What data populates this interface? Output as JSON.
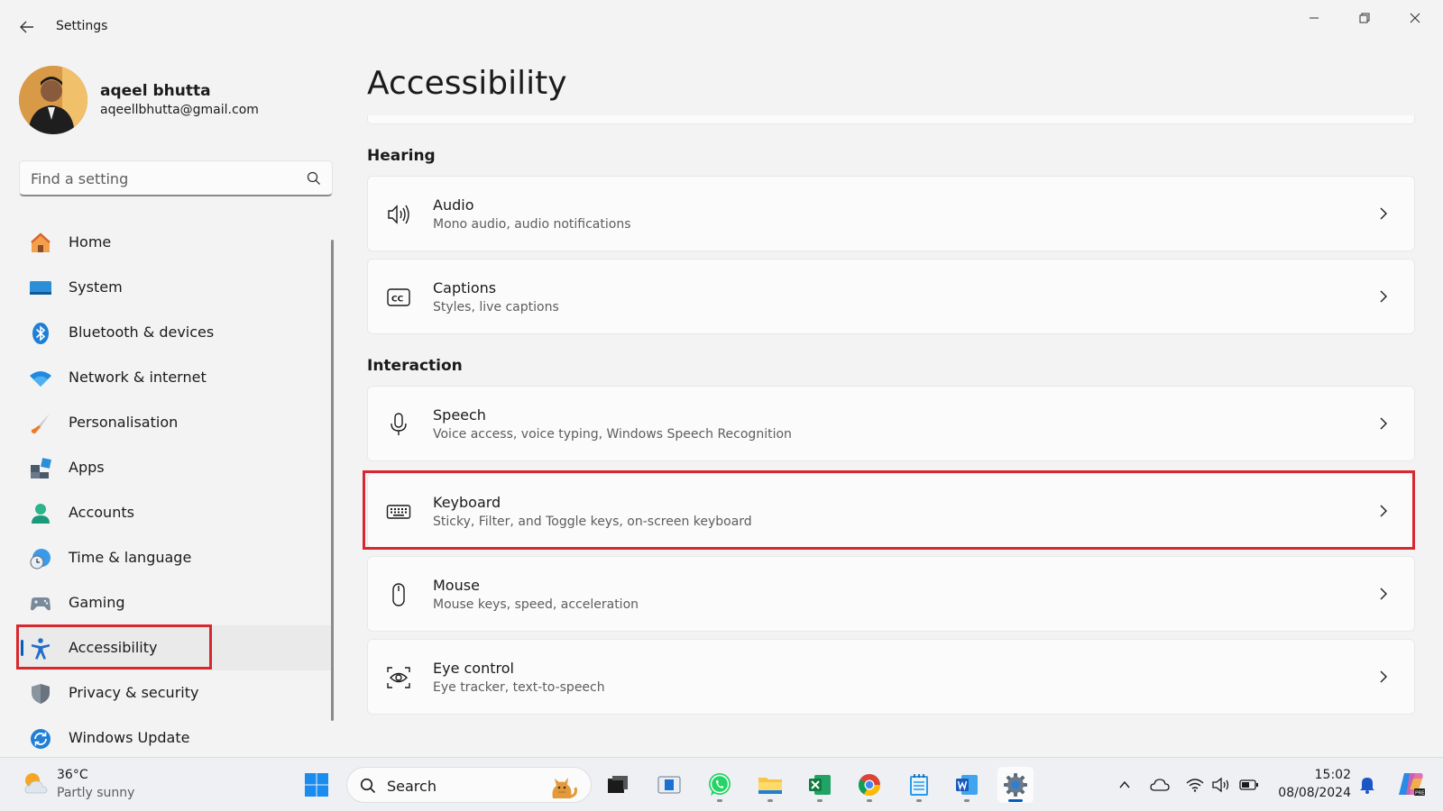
{
  "window": {
    "title": "Settings",
    "back_icon": "back-arrow-icon",
    "controls": [
      "minimize-icon",
      "restore-icon",
      "close-icon"
    ]
  },
  "user": {
    "name": "aqeel bhutta",
    "email": "aqeellbhutta@gmail.com"
  },
  "search": {
    "placeholder": "Find a setting"
  },
  "sidebar": {
    "items": [
      {
        "label": "Home",
        "icon": "home-icon"
      },
      {
        "label": "System",
        "icon": "system-icon"
      },
      {
        "label": "Bluetooth & devices",
        "icon": "bluetooth-icon"
      },
      {
        "label": "Network & internet",
        "icon": "wifi-icon"
      },
      {
        "label": "Personalisation",
        "icon": "brush-icon"
      },
      {
        "label": "Apps",
        "icon": "apps-icon"
      },
      {
        "label": "Accounts",
        "icon": "accounts-icon"
      },
      {
        "label": "Time & language",
        "icon": "clock-globe-icon"
      },
      {
        "label": "Gaming",
        "icon": "gamepad-icon"
      },
      {
        "label": "Accessibility",
        "icon": "accessibility-icon",
        "active": true
      },
      {
        "label": "Privacy & security",
        "icon": "shield-icon"
      },
      {
        "label": "Windows Update",
        "icon": "update-icon"
      }
    ]
  },
  "main": {
    "title": "Accessibility",
    "sections": [
      {
        "label": "Hearing",
        "cards": [
          {
            "title": "Audio",
            "subtitle": "Mono audio, audio notifications",
            "icon": "speaker-icon"
          },
          {
            "title": "Captions",
            "subtitle": "Styles, live captions",
            "icon": "captions-icon"
          }
        ]
      },
      {
        "label": "Interaction",
        "cards": [
          {
            "title": "Speech",
            "subtitle": "Voice access, voice typing, Windows Speech Recognition",
            "icon": "microphone-icon"
          },
          {
            "title": "Keyboard",
            "subtitle": "Sticky, Filter, and Toggle keys, on-screen keyboard",
            "icon": "keyboard-icon"
          },
          {
            "title": "Mouse",
            "subtitle": "Mouse keys, speed, acceleration",
            "icon": "mouse-icon"
          },
          {
            "title": "Eye control",
            "subtitle": "Eye tracker, text-to-speech",
            "icon": "eye-control-icon"
          }
        ]
      }
    ]
  },
  "taskbar": {
    "weather": {
      "temp": "36°C",
      "desc": "Partly sunny"
    },
    "search_label": "Search",
    "apps": [
      "windows-start-icon",
      "task-view-icon",
      "media-player-icon",
      "whatsapp-icon",
      "file-explorer-icon",
      "excel-icon",
      "chrome-icon",
      "notepad-icon",
      "word-icon",
      "settings-gear-icon"
    ],
    "clock": {
      "time": "15:02",
      "date": "08/08/2024"
    }
  },
  "colors": {
    "accent": "#005fb8",
    "highlight": "#d8282f"
  }
}
